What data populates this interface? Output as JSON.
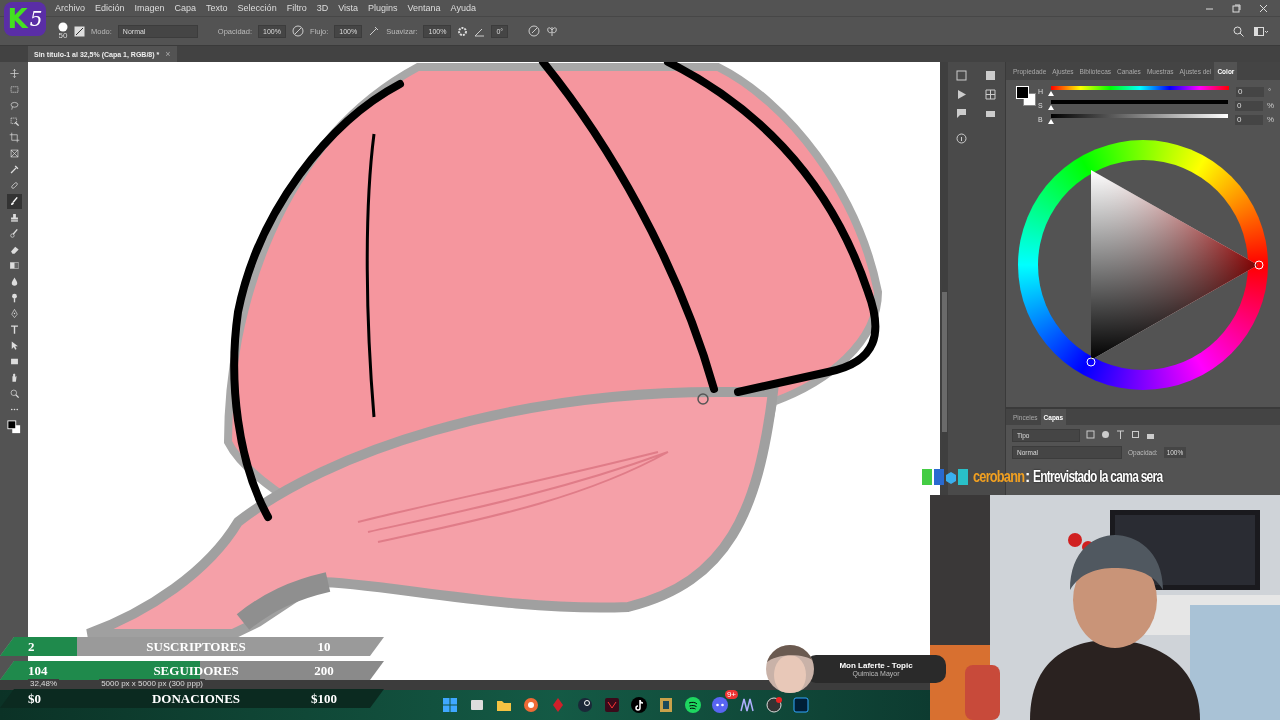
{
  "menu": [
    "Archivo",
    "Edición",
    "Imagen",
    "Capa",
    "Texto",
    "Selección",
    "Filtro",
    "3D",
    "Vista",
    "Plugins",
    "Ventana",
    "Ayuda"
  ],
  "options": {
    "brush_size": "50",
    "mode_label": "Modo:",
    "mode": "Normal",
    "opacity_label": "Opacidad:",
    "opacity": "100%",
    "flow_label": "Flujo:",
    "flow": "100%",
    "smooth_label": "Suavizar:",
    "smooth": "100%",
    "angle": "0°"
  },
  "document_tab": {
    "title": "Sin título-1 al 32,5% (Capa 1, RGB/8) *",
    "close": "×"
  },
  "panel_tabs": [
    {
      "label": "Propiedade",
      "selected": false
    },
    {
      "label": "Ajustes",
      "selected": false
    },
    {
      "label": "Bibliotecas",
      "selected": false
    },
    {
      "label": "Canales",
      "selected": false
    },
    {
      "label": "Muestras",
      "selected": false
    },
    {
      "label": "Ajustes del",
      "selected": false
    },
    {
      "label": "Color",
      "selected": true
    }
  ],
  "color_sliders": [
    {
      "label": "H",
      "value": "0",
      "unit": "°",
      "kind": "hue",
      "level": 0
    },
    {
      "label": "S",
      "value": "0",
      "unit": "%",
      "kind": "saturation",
      "level": 0
    },
    {
      "label": "B",
      "value": "0",
      "unit": "%",
      "kind": "brightness",
      "level": 0
    }
  ],
  "layers_panel": {
    "tabs": [
      {
        "label": "Pinceles",
        "selected": false
      },
      {
        "label": "Capas",
        "selected": true
      }
    ],
    "filter": "Tipo",
    "blend_mode": "Normal",
    "opacity_label": "Opacidad:",
    "opacity": "100%"
  },
  "status_bar": {
    "zoom": "32,48%",
    "size": "5000 px x 5000 px (300 ppp)"
  },
  "stream_overlay": {
    "logo": {
      "mark": "K",
      "number": "5"
    },
    "chat": {
      "user": "cerobann",
      "separator": ":",
      "message": "Entrevistado la cama sera"
    },
    "goals": [
      {
        "current": "2",
        "label": "SUSCRIPTORES",
        "target": "10",
        "level": 0.2
      },
      {
        "current": "104",
        "label": "SEGUIDORES",
        "target": "200",
        "level": 0.52
      },
      {
        "current": "$0",
        "label": "DONACIONES",
        "target": "$100",
        "level": 0
      }
    ],
    "now_playing": {
      "title": "Mon Laferte - Topic",
      "subtitle": "Quimica Mayor"
    }
  },
  "taskbar": {
    "discord_badge": "9+"
  }
}
